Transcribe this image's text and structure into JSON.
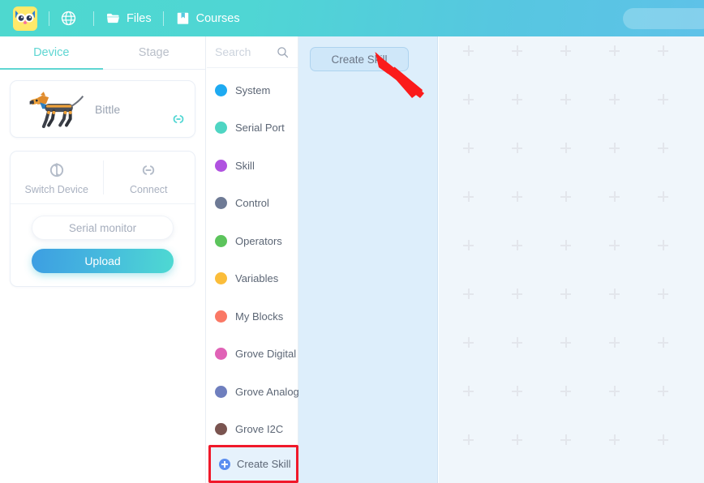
{
  "header": {
    "logo_alt": "owl-logo",
    "items": [
      {
        "icon": "globe-icon",
        "label": ""
      },
      {
        "icon": "folder-icon",
        "label": "Files"
      },
      {
        "icon": "book-icon",
        "label": "Courses"
      }
    ],
    "account_pill": ""
  },
  "left_panel": {
    "tabs": [
      {
        "label": "Device",
        "active": true
      },
      {
        "label": "Stage",
        "active": false
      }
    ],
    "device": {
      "name": "Bittle",
      "link_icon": "link-icon"
    },
    "controls": {
      "switch_device_label": "Switch Device",
      "switch_device_icon": "swap-icon",
      "connect_label": "Connect",
      "connect_icon": "link-icon",
      "serial_monitor_label": "Serial monitor",
      "upload_label": "Upload"
    }
  },
  "categories": {
    "search_placeholder": "Search",
    "search_value": "",
    "search_icon": "search-icon",
    "items": [
      {
        "label": "System",
        "color": "#1eaaf1"
      },
      {
        "label": "Serial Port",
        "color": "#4fd5c3"
      },
      {
        "label": "Skill",
        "color": "#b052e0"
      },
      {
        "label": "Control",
        "color": "#6e7a95"
      },
      {
        "label": "Operators",
        "color": "#5cc45c"
      },
      {
        "label": "Variables",
        "color": "#fbbd3a"
      },
      {
        "label": "My Blocks",
        "color": "#fa7865"
      },
      {
        "label": "Grove Digital",
        "color": "#e062b6"
      },
      {
        "label": "Grove Analog",
        "color": "#6f7fbe"
      },
      {
        "label": "Grove I2C",
        "color": "#7a5450"
      }
    ],
    "create_skill": {
      "label": "Create Skill",
      "icon": "plus-circle-icon",
      "highlight_color": "#f0192a"
    }
  },
  "palette": {
    "create_skill_button_label": "Create Skill"
  },
  "annotation": {
    "arrow_color": "#fb1b1b",
    "points_to": "Create Skill"
  },
  "canvas": {
    "grid_icon": "plus-grid-marker",
    "background_color": "#f0f6fb"
  }
}
